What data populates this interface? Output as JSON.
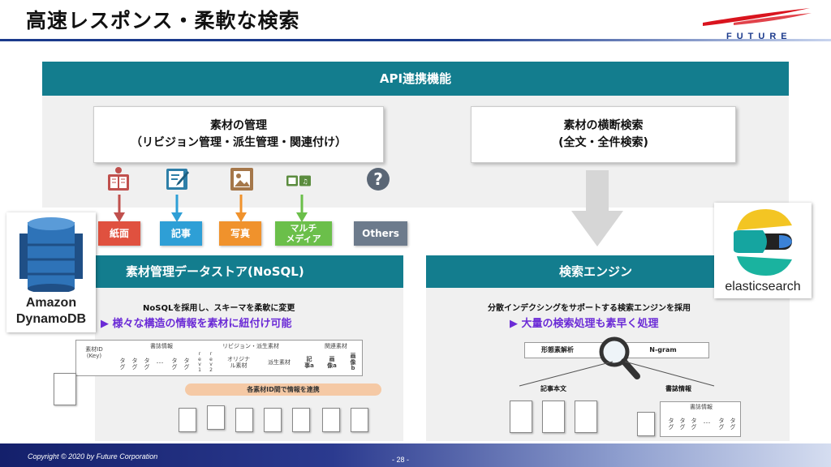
{
  "slide_title": "高速レスポンス・柔軟な検索",
  "brand": "FUTURE",
  "api": {
    "header": "API連携機能",
    "box_left_line1": "素材の管理",
    "box_left_line2": "（リビジョン管理・派生管理・関連付け）",
    "box_right_line1": "素材の横断検索",
    "box_right_line2": "(全文・全件検索)"
  },
  "tags": [
    {
      "label": "紙面",
      "color": "#e0513f"
    },
    {
      "label": "記事",
      "color": "#2e9fd6"
    },
    {
      "label": "写真",
      "color": "#f0922c"
    },
    {
      "label": "マルチ\nメディア",
      "color": "#6bbf4a"
    },
    {
      "label": "Others",
      "color": "#6d7b8c"
    }
  ],
  "left_panel": {
    "header": "素材管理データストア(NoSQL)",
    "sub": "NoSQLを採用し、スキーマを柔軟に変更",
    "highlight": "▶ 様々な構造の情報を素材に紐付け可能",
    "table": {
      "key_label": "素材ID\n(Key)",
      "group1": "書誌情報",
      "group2": "リビジョン・派生素材",
      "group3": "関連素材",
      "tag": "タ\nグ",
      "ellipsis": "…",
      "rev": "r\ne\nv\n1",
      "rev2": "r\ne\nv\n2",
      "original": "オリジナ\nル素材",
      "derived": "派生素材",
      "article_a": "記\n事a",
      "image_a": "画\n像a",
      "image_b": "画\n像\nb"
    },
    "pill": "各素材ID間で情報を連携"
  },
  "right_panel": {
    "header": "検索エンジン",
    "sub": "分散インデクシングをサポートする検索エンジンを採用",
    "highlight": "▶ 大量の検索処理も素早く処理",
    "morph": "形態素解析",
    "ngram": "N-gram",
    "article_body": "記事本文",
    "biblio": "書誌情報",
    "biblio_small": "書誌情報",
    "tag": "タ\nグ",
    "ellipsis": "…"
  },
  "dynamodb": {
    "line1": "Amazon",
    "line2": "DynamoDB"
  },
  "elastic": {
    "label": "elasticsearch"
  },
  "footer": {
    "copyright": "Copyright © 2020 by Future Corporation",
    "page": "- 28 -"
  }
}
